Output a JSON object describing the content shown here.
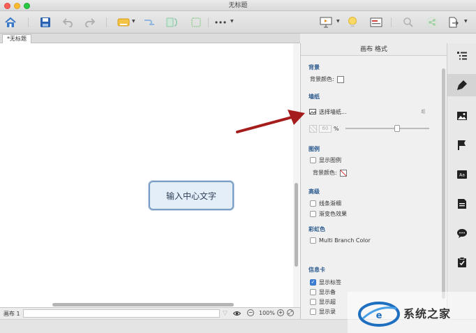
{
  "window": {
    "title": "无标题"
  },
  "toolbar": {
    "icons": [
      "home-icon",
      "save-icon",
      "undo-icon",
      "redo-icon",
      "insert-topic-icon",
      "relationship-icon",
      "summary-icon",
      "boundary-icon",
      "more-icon",
      "presentation-icon",
      "idea-icon",
      "outline-icon",
      "search-icon",
      "share-icon",
      "export-icon"
    ]
  },
  "tab": {
    "label": "*无标题"
  },
  "canvas": {
    "central_topic": "输入中心文字"
  },
  "status": {
    "sheet_label": "画布 1",
    "zoom": "100%"
  },
  "panel": {
    "title": "画布 格式",
    "background": {
      "heading": "背景",
      "color_label": "背景颜色:"
    },
    "wallpaper": {
      "heading": "墙纸",
      "select_label": "选择墙纸...",
      "opacity_value": "60",
      "opacity_unit": "%"
    },
    "legend": {
      "heading": "图例",
      "show_label": "显示图例",
      "bg_color_label": "背景颜色:"
    },
    "advanced": {
      "heading": "高级",
      "taper_label": "线条渐细",
      "gradient_label": "渐变色效果"
    },
    "rainbow": {
      "heading": "彩虹色",
      "multi_branch_label": "Multi Branch Color"
    },
    "info_card": {
      "heading": "信息卡",
      "items": [
        "显示标签",
        "显示备",
        "显示超",
        "显示录"
      ],
      "checked": [
        true,
        false,
        false,
        false
      ]
    }
  },
  "sidebar": {
    "icons": [
      "outline-icon",
      "format-brush-icon",
      "image-icon",
      "flag-icon",
      "text-icon",
      "notes-icon",
      "comment-icon",
      "task-icon"
    ]
  },
  "watermark": {
    "text": "系统之家"
  },
  "colors": {
    "accent": "#2b5a8e",
    "topic_border": "#7b9ec5",
    "arrow": "#a51c1c"
  }
}
